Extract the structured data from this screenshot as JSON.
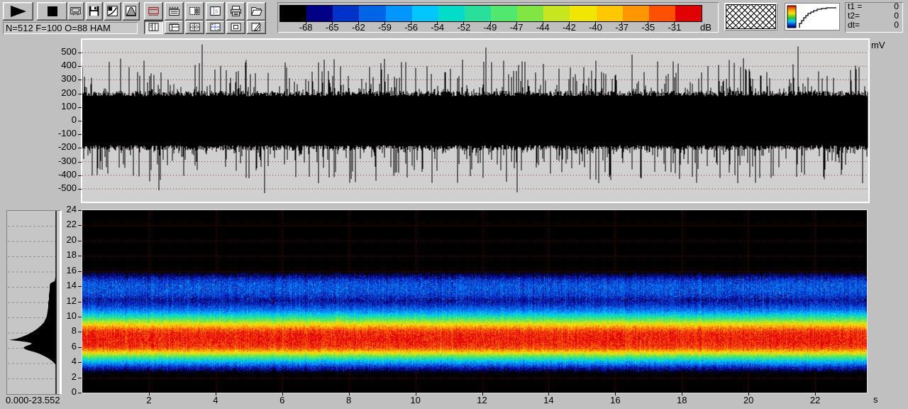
{
  "window": {
    "background": "#c0c0c0"
  },
  "toolbar": {
    "status_text": "N=512 F=100 O=88 HAM",
    "transport": [
      {
        "icon": "play-icon"
      },
      {
        "icon": "stop-icon"
      }
    ],
    "file_group": [
      {
        "icon": "scope-display-icon"
      },
      {
        "icon": "save-floppy-icon"
      },
      {
        "icon": "gamma-curve-icon"
      },
      {
        "icon": "window-function-icon"
      }
    ],
    "display_group": [
      {
        "icon": "red-frame-display-icon"
      },
      {
        "icon": "comb-display-icon"
      },
      {
        "icon": "shaded-region-icon"
      },
      {
        "icon": "s-grid-icon"
      },
      {
        "icon": "printer-icon"
      },
      {
        "icon": "open-folder-icon"
      }
    ],
    "layout_group": [
      {
        "icon": "grid-vertical-icon",
        "pressed": true
      },
      {
        "icon": "grid-top-dashed-icon",
        "pressed": false
      },
      {
        "icon": "grid-cross-icon",
        "pressed": false
      },
      {
        "icon": "grid-cross-axes-icon",
        "pressed": false
      },
      {
        "icon": "grid-inner-box-icon",
        "pressed": false
      },
      {
        "icon": "grid-edit-icon",
        "pressed": false
      }
    ]
  },
  "colorbar": {
    "unit": "dB",
    "labels": [
      "-68",
      "-65",
      "-62",
      "-59",
      "-56",
      "-54",
      "-52",
      "-49",
      "-47",
      "-44",
      "-42",
      "-40",
      "-37",
      "-35",
      "-31"
    ],
    "colors": [
      "#000000",
      "#000086",
      "#0032c8",
      "#0064e6",
      "#0096ff",
      "#00c8ff",
      "#00dcc8",
      "#28e09b",
      "#50e86e",
      "#82e642",
      "#c8e61e",
      "#f0e600",
      "#ffc800",
      "#ff9600",
      "#ff5000",
      "#e00000"
    ]
  },
  "time_readout": {
    "rows": [
      {
        "label": "t1 =",
        "value": "0"
      },
      {
        "label": "t2=",
        "value": "0"
      },
      {
        "label": "dt=",
        "value": "0"
      }
    ]
  },
  "chart_data": [
    {
      "id": "waveform",
      "type": "line",
      "title": "",
      "y_unit": "mV",
      "yticks": [
        500,
        400,
        300,
        200,
        100,
        0,
        -100,
        -200,
        -300,
        -400,
        -500
      ],
      "ylim": [
        -560,
        560
      ],
      "x_range_s": [
        0,
        23.552
      ],
      "background": "#d0d0d0",
      "gridline_color": "#8b2a2a",
      "noise": {
        "seed": 1337,
        "core_mv": 180,
        "core_jitter_mv": 40,
        "spike_prob": 0.22,
        "spike_base_mv": 230,
        "spike_extra_mv": 230,
        "rare_prob": 0.0035,
        "rare_base_mv": 480,
        "rare_extra_mv": 60
      },
      "feature_spikes": [
        {
          "t_s": 3.6,
          "mv": 560
        },
        {
          "t_s": 21.49,
          "mv": 545
        }
      ]
    },
    {
      "id": "spectrogram",
      "type": "heatmap",
      "title": "",
      "x_unit": "s",
      "xticks": [
        2,
        4,
        6,
        8,
        10,
        12,
        14,
        16,
        18,
        20,
        22
      ],
      "x_range_s": [
        0,
        23.552
      ],
      "y_range_khz": [
        0,
        24
      ],
      "yticks": [
        24,
        22,
        20,
        18,
        16,
        14,
        12,
        10,
        8,
        6,
        4,
        2,
        0
      ],
      "intensity_unit": "dB",
      "gridline_color": "#8a0000",
      "seed": 77,
      "jitter_db": 4.5,
      "column_jitter_db": 3,
      "speckle": {
        "f_min": 12.0,
        "f_max": 15.2,
        "hot_prob": 0.004,
        "hot_db": -36,
        "cyan_prob": 0.03,
        "cyan_boost_db": 7
      },
      "band_profile_f_db": [
        [
          0,
          -100
        ],
        [
          2.2,
          -100
        ],
        [
          2.6,
          -72
        ],
        [
          3.0,
          -67
        ],
        [
          3.4,
          -64
        ],
        [
          3.8,
          -59
        ],
        [
          4.2,
          -55
        ],
        [
          4.6,
          -50
        ],
        [
          5.0,
          -45
        ],
        [
          5.4,
          -39
        ],
        [
          5.8,
          -34
        ],
        [
          6.2,
          -31.5
        ],
        [
          7.0,
          -30.5
        ],
        [
          7.8,
          -31
        ],
        [
          8.2,
          -32.5
        ],
        [
          8.6,
          -36
        ],
        [
          9.0,
          -40
        ],
        [
          9.4,
          -44.5
        ],
        [
          9.8,
          -49
        ],
        [
          10.2,
          -53
        ],
        [
          10.6,
          -57
        ],
        [
          11.0,
          -60
        ],
        [
          11.6,
          -63.5
        ],
        [
          12.2,
          -65.5
        ],
        [
          12.8,
          -63
        ],
        [
          13.4,
          -61.5
        ],
        [
          14.2,
          -61.5
        ],
        [
          14.8,
          -63
        ],
        [
          15.3,
          -66
        ],
        [
          15.8,
          -69.5
        ],
        [
          16.4,
          -82
        ],
        [
          24,
          -100
        ]
      ]
    },
    {
      "id": "average-spectrum-profile",
      "type": "area",
      "orientation": "vertical",
      "range_label": "0.000-23.552",
      "f_range_khz": [
        0,
        24
      ],
      "gridline_color": "#8f8f8f",
      "points_f_width": [
        [
          24,
          0
        ],
        [
          15.6,
          0
        ],
        [
          15.2,
          1
        ],
        [
          14.8,
          2
        ],
        [
          14.5,
          8
        ],
        [
          14.2,
          9
        ],
        [
          13.6,
          9
        ],
        [
          13.0,
          10
        ],
        [
          12.4,
          10
        ],
        [
          12.0,
          11
        ],
        [
          11.4,
          11
        ],
        [
          10.8,
          12
        ],
        [
          10.2,
          13
        ],
        [
          9.8,
          15
        ],
        [
          9.4,
          17
        ],
        [
          9.0,
          21
        ],
        [
          8.6,
          26
        ],
        [
          8.2,
          32
        ],
        [
          7.8,
          40
        ],
        [
          7.5,
          48
        ],
        [
          7.25,
          56
        ],
        [
          7.1,
          66
        ],
        [
          6.95,
          52
        ],
        [
          6.8,
          40
        ],
        [
          6.65,
          34
        ],
        [
          6.5,
          36
        ],
        [
          6.3,
          42
        ],
        [
          6.1,
          46
        ],
        [
          5.9,
          44
        ],
        [
          5.7,
          38
        ],
        [
          5.5,
          30
        ],
        [
          5.3,
          24
        ],
        [
          5.1,
          19
        ],
        [
          4.9,
          15
        ],
        [
          4.7,
          11
        ],
        [
          4.5,
          8
        ],
        [
          4.3,
          5
        ],
        [
          4.1,
          3
        ],
        [
          3.9,
          1
        ],
        [
          3.7,
          0
        ],
        [
          0,
          0
        ]
      ]
    }
  ]
}
